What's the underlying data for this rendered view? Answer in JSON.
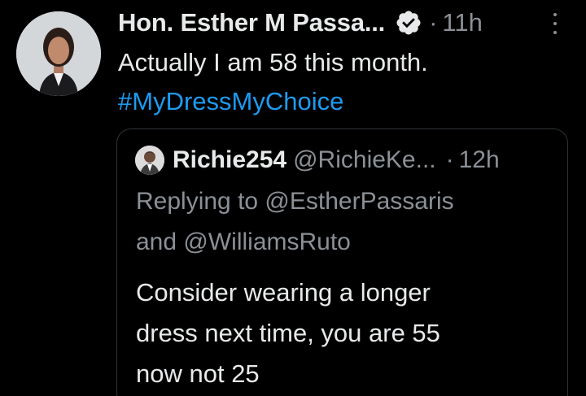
{
  "tweet": {
    "author_name": "Hon. Esther M Passa...",
    "separator": "·",
    "time": "11h",
    "text_line1": "Actually I am 58 this month.",
    "hashtag": "#MyDressMyChoice"
  },
  "quoted": {
    "author_name": "Richie254",
    "handle": "@RichieKe...",
    "separator": "·",
    "time": "12h",
    "replying_line1": "Replying to @EstherPassaris",
    "replying_line2": "and @WilliamsRuto",
    "text_line1": "Consider wearing a longer",
    "text_line2": "dress next time, you are 55",
    "text_line3": "now not 25"
  },
  "icons": {
    "verified": "verified-badge-icon",
    "more": "more-options-icon"
  },
  "colors": {
    "background": "#000000",
    "text": "#e7e9ea",
    "muted": "#8b9096",
    "link": "#1d9bf0",
    "border": "#2f3336"
  }
}
